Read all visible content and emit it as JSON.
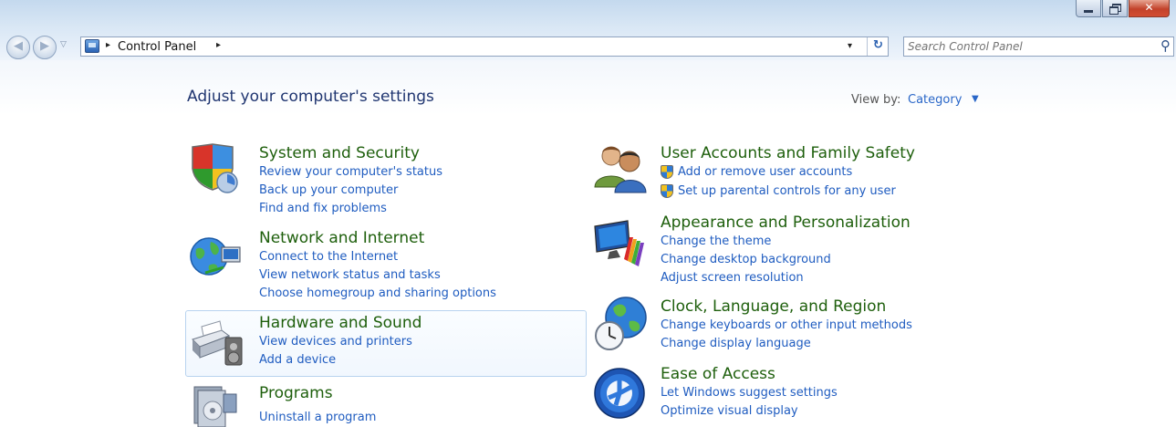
{
  "window": {
    "caption_buttons": {
      "minimize": "minimize",
      "maximize": "restore",
      "close": "✕"
    }
  },
  "nav": {
    "back_arrow": "◀",
    "forward_arrow": "▶",
    "recent_pages": "▽"
  },
  "address_bar": {
    "icon": "control-panel-icon",
    "breadcrumb": "Control Panel",
    "separator": "▸",
    "dropdown": "▾",
    "refresh": "↻"
  },
  "search": {
    "placeholder": "Search Control Panel",
    "icon": "⚲"
  },
  "page": {
    "title": "Adjust your computer's settings",
    "view_by_label": "View by:",
    "view_by_value": "Category",
    "view_by_caret": "▼"
  },
  "categories_left": [
    {
      "title": "System and Security",
      "icon": "shield-icon",
      "links": [
        "Review your computer's status",
        "Back up your computer",
        "Find and fix problems"
      ]
    },
    {
      "title": "Network and Internet",
      "icon": "globe-network-icon",
      "links": [
        "Connect to the Internet",
        "View network status and tasks",
        "Choose homegroup and sharing options"
      ]
    },
    {
      "title": "Hardware and Sound",
      "icon": "printer-speaker-icon",
      "links": [
        "View devices and printers",
        "Add a device"
      ]
    },
    {
      "title": "Programs",
      "icon": "programs-icon",
      "links": [
        "Uninstall a program"
      ]
    }
  ],
  "categories_right": [
    {
      "title": "User Accounts and Family Safety",
      "icon": "users-icon",
      "links": [
        "Add or remove user accounts",
        "Set up parental controls for any user"
      ]
    },
    {
      "title": "Appearance and Personalization",
      "icon": "monitor-palette-icon",
      "links": [
        "Change the theme",
        "Change desktop background",
        "Adjust screen resolution"
      ]
    },
    {
      "title": "Clock, Language, and Region",
      "icon": "globe-clock-icon",
      "links": [
        "Change keyboards or other input methods",
        "Change display language"
      ]
    },
    {
      "title": "Ease of Access",
      "icon": "ease-of-access-icon",
      "links": [
        "Let Windows suggest settings",
        "Optimize visual display"
      ]
    }
  ],
  "colors": {
    "category_title": "#1e5f0c",
    "link": "#1f5cc0",
    "hover_border": "#b8d3ef"
  }
}
